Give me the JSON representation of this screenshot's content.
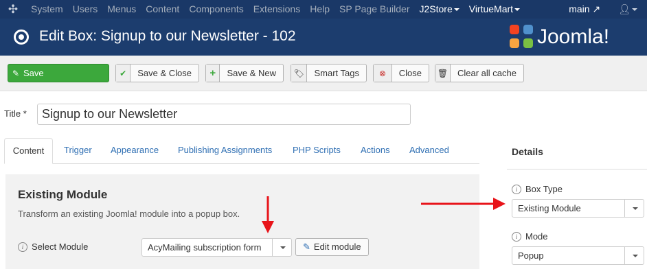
{
  "topnav": {
    "items": [
      "System",
      "Users",
      "Menus",
      "Content",
      "Components",
      "Extensions",
      "Help",
      "SP Page Builder",
      "J2Store",
      "VirtueMart"
    ],
    "site": "main"
  },
  "header": {
    "title": "Edit Box: Signup to our Newsletter - 102",
    "logo_text": "Joomla!"
  },
  "toolbar": {
    "save": "Save",
    "save_close": "Save & Close",
    "save_new": "Save & New",
    "smart_tags": "Smart Tags",
    "close": "Close",
    "clear_cache": "Clear all cache"
  },
  "form": {
    "title_label": "Title *",
    "title_value": "Signup to our Newsletter"
  },
  "tabs": [
    "Content",
    "Trigger",
    "Appearance",
    "Publishing Assignments",
    "PHP Scripts",
    "Actions",
    "Advanced"
  ],
  "panel": {
    "heading": "Existing Module",
    "description": "Transform an existing Joomla! module into a popup box.",
    "select_label": "Select Module",
    "select_value": "AcyMailing subscription form",
    "edit_button": "Edit module"
  },
  "sidebar": {
    "title": "Details",
    "box_type_label": "Box Type",
    "box_type_value": "Existing Module",
    "mode_label": "Mode",
    "mode_value": "Popup"
  },
  "colors": {
    "nav_bg": "#1a3867",
    "header_bg": "#1c3d6e",
    "success": "#3ca83c",
    "link": "#2f6fb3",
    "annotation_red": "#e8141a"
  }
}
